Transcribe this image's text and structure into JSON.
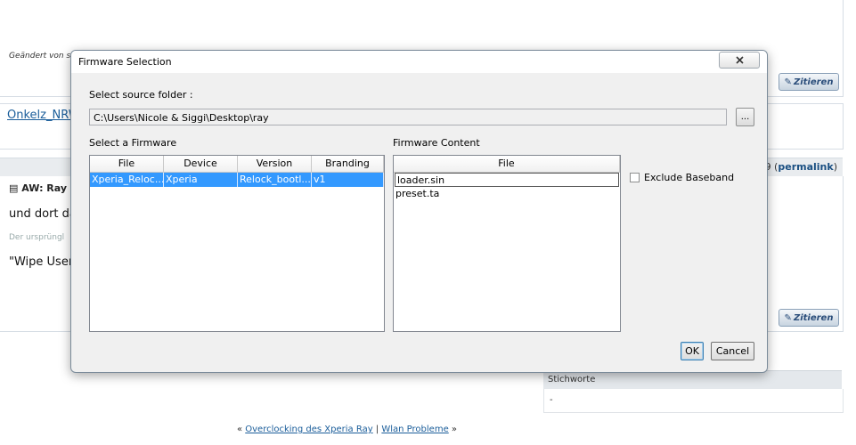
{
  "background": {
    "edited_by": "Geändert von s",
    "link_user": "Onkelz_NRW",
    "permalink_prefix": "9",
    "permalink_label": "permalink",
    "post_title": "AW: Ray n",
    "post_line1": "und dort da",
    "post_line2": "Der ursprüngl",
    "post_line3": "\"Wipe User",
    "quote_label": "Zitieren",
    "tags_heading": "Stichworte",
    "tags_value": "-",
    "nav_prev_arrow": "«",
    "nav_prev": "Overclocking des Xperia Ray",
    "nav_sep": "|",
    "nav_next": "Wlan Probleme",
    "nav_next_arrow": "»"
  },
  "dialog": {
    "title": "Firmware Selection",
    "source_label": "Select source folder :",
    "source_path": "C:\\Users\\Nicole & Siggi\\Desktop\\ray",
    "browse_label": "...",
    "firmware_label": "Select a Firmware",
    "firmware_columns": [
      "File",
      "Device",
      "Version",
      "Branding"
    ],
    "firmware_rows": [
      [
        "Xperia_Reloc...",
        "Xperia",
        "Relock_bootl...",
        "v1"
      ]
    ],
    "content_label": "Firmware Content",
    "content_column": "File",
    "content_files": [
      "loader.sin",
      "preset.ta"
    ],
    "exclude_baseband_label": "Exclude Baseband",
    "exclude_baseband_checked": false,
    "ok_label": "OK",
    "cancel_label": "Cancel"
  }
}
